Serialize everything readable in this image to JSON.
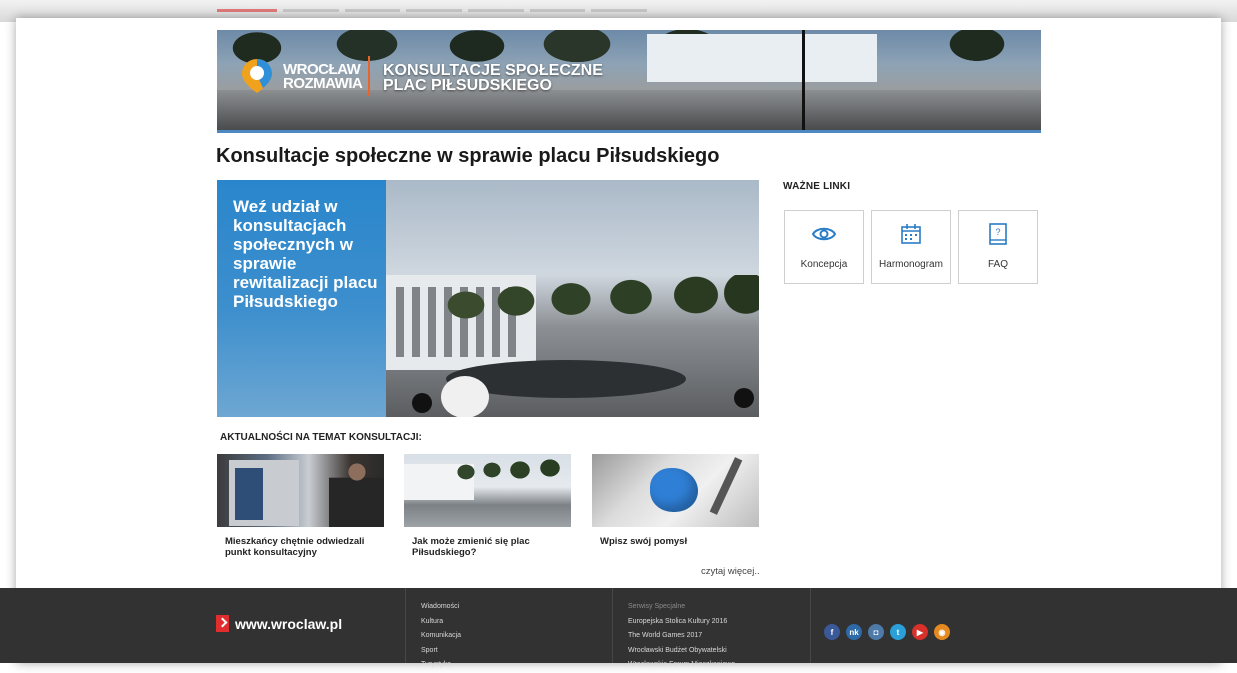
{
  "banner": {
    "logo_line1": "WROCŁAW",
    "logo_line2": "ROZMAWIA",
    "title_line1": "KONSULTACJE SPOŁECZNE",
    "title_line2": "PLAC PIŁSUDSKIEGO",
    "accent_color": "#e8642a",
    "border_color": "#4e88c2"
  },
  "page_title": "Konsultacje społeczne w sprawie placu Piłsudskiego",
  "hero": {
    "text": "Weź udział w konsultacjach społecznych w sprawie rewitalizacji placu Piłsudskiego",
    "panel_color": "#2a86cc"
  },
  "links": {
    "heading": "WAŻNE LINKI",
    "items": [
      {
        "label": "Koncepcja",
        "icon": "eye-icon"
      },
      {
        "label": "Harmonogram",
        "icon": "calendar-icon"
      },
      {
        "label": "FAQ",
        "icon": "book-question-icon"
      }
    ]
  },
  "news": {
    "heading": "AKTUALNOŚCI NA TEMAT KONSULTACJI:",
    "items": [
      {
        "caption": "Mieszkańcy chętnie odwiedzali punkt konsultacyjny"
      },
      {
        "caption": "Jak może zmienić się plac Piłsudskiego?"
      },
      {
        "caption": "Wpisz swój pomysł"
      }
    ],
    "more": "czytaj więcej.."
  },
  "footer": {
    "domain": "www.wroclaw.pl",
    "nav": [
      "Wiadomości",
      "Kultura",
      "Komunikacja",
      "Sport",
      "Turystyka"
    ],
    "special_heading": "Serwisy Specjalne",
    "special": [
      "Europejska Stolica Kultury 2016",
      "The World Games 2017",
      "Wrocławski Budżet Obywatelski",
      "Wrocławskie Forum Mieszkaniowe"
    ],
    "social": [
      {
        "icon": "facebook-icon",
        "glyph": "f",
        "color": "#3b5998"
      },
      {
        "icon": "nk-icon",
        "glyph": "nk",
        "color": "#2e6aa8"
      },
      {
        "icon": "instagram-icon",
        "glyph": "◘",
        "color": "#4d7aa8"
      },
      {
        "icon": "twitter-icon",
        "glyph": "t",
        "color": "#2a9fd8"
      },
      {
        "icon": "youtube-icon",
        "glyph": "▶",
        "color": "#d8302a"
      },
      {
        "icon": "rss-icon",
        "glyph": "◉",
        "color": "#e58a1f"
      }
    ]
  }
}
